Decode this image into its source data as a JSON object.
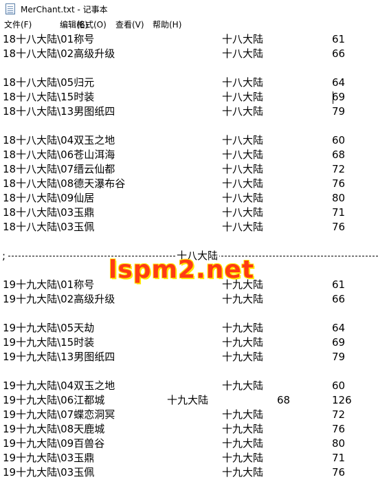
{
  "window": {
    "title": "MerChant.txt - 记事本",
    "app_icon": "notepad-icon"
  },
  "menu": {
    "items": [
      "文件(F)",
      "编辑(E)",
      "格式(O)",
      "查看(V)",
      "帮助(H)"
    ]
  },
  "lines": [
    {
      "path": "18十八大陆\\01称号",
      "region": "十八大陆",
      "num": "61",
      "extra": ""
    },
    {
      "path": "18十八大陆\\02高级升级",
      "region": "十八大陆",
      "num": "66",
      "extra": ""
    },
    {
      "path": "",
      "region": "",
      "num": "",
      "extra": ""
    },
    {
      "path": "18十八大陆\\05归元",
      "region": "十八大陆",
      "num": "64",
      "extra": ""
    },
    {
      "path": "18十八大陆\\15时装",
      "region": "十八大陆",
      "num": "69",
      "extra": ""
    },
    {
      "path": "18十八大陆\\13男图纸四",
      "region": "十八大陆",
      "num": "79",
      "extra": ""
    },
    {
      "path": "",
      "region": "",
      "num": "",
      "extra": ""
    },
    {
      "path": "18十八大陆\\04双玉之地",
      "region": "十八大陆",
      "num": "60",
      "extra": ""
    },
    {
      "path": "18十八大陆\\06苍山洱海",
      "region": "十八大陆",
      "num": "68",
      "extra": ""
    },
    {
      "path": "18十八大陆\\07缙云仙都",
      "region": "十八大陆",
      "num": "72",
      "extra": ""
    },
    {
      "path": "18十八大陆\\08德天瀑布谷",
      "region": "十八大陆",
      "num": "76",
      "extra": ""
    },
    {
      "path": "18十八大陆\\09仙居",
      "region": "十八大陆",
      "num": "80",
      "extra": ""
    },
    {
      "path": "18十八大陆\\03玉鼎",
      "region": "十八大陆",
      "num": "71",
      "extra": ""
    },
    {
      "path": "18十八大陆\\03玉佩",
      "region": "十八大陆",
      "num": "76",
      "extra": ""
    },
    {
      "path": "",
      "region": "",
      "num": "",
      "extra": ""
    },
    {
      "separator": true,
      "prefix": ";",
      "label": "十八大陆"
    },
    {
      "path": "",
      "region": "",
      "num": "",
      "extra": ""
    },
    {
      "path": "19十九大陆\\01称号",
      "region": "十九大陆",
      "num": "61",
      "extra": ""
    },
    {
      "path": "19十九大陆\\02高级升级",
      "region": "十九大陆",
      "num": "66",
      "extra": ""
    },
    {
      "path": "",
      "region": "",
      "num": "",
      "extra": ""
    },
    {
      "path": "19十九大陆\\05天劫",
      "region": "十九大陆",
      "num": "64",
      "extra": ""
    },
    {
      "path": "19十九大陆\\15时装",
      "region": "十九大陆",
      "num": "69",
      "extra": ""
    },
    {
      "path": "19十九大陆\\13男图纸四",
      "region": "十九大陆",
      "num": "79",
      "extra": ""
    },
    {
      "path": "",
      "region": "",
      "num": "",
      "extra": ""
    },
    {
      "path": "19十九大陆\\04双玉之地",
      "region": "十九大陆",
      "num": "60",
      "extra": ""
    },
    {
      "path": "19十九大陆\\06江都城",
      "region": "十九大陆",
      "num": "68",
      "extra": "126",
      "shifted": true
    },
    {
      "path": "19十九大陆\\07蝶恋洞冥",
      "region": "十九大陆",
      "num": "72",
      "extra": ""
    },
    {
      "path": "19十九大陆\\08天鹿城",
      "region": "十九大陆",
      "num": "76",
      "extra": ""
    },
    {
      "path": "19十九大陆\\09百兽谷",
      "region": "十九大陆",
      "num": "80",
      "extra": ""
    },
    {
      "path": "19十九大陆\\03玉鼎",
      "region": "十九大陆",
      "num": "71",
      "extra": ""
    },
    {
      "path": "19十九大陆\\03玉佩",
      "region": "十九大陆",
      "num": "76",
      "extra": ""
    }
  ],
  "watermark": "lspm2.net"
}
